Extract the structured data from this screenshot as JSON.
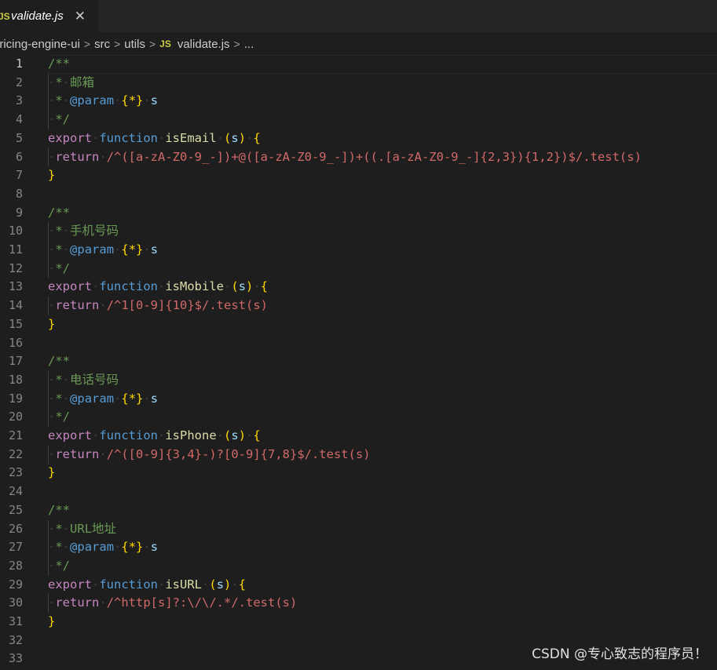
{
  "tab": {
    "icon": "JS",
    "title": "validate.js",
    "close": "✕"
  },
  "breadcrumb": {
    "project": "pricing-engine-ui",
    "src": "src",
    "utils": "utils",
    "file_icon": "JS",
    "file": "validate.js",
    "more": "..."
  },
  "line_numbers": [
    "1",
    "2",
    "3",
    "4",
    "5",
    "6",
    "7",
    "8",
    "9",
    "10",
    "11",
    "12",
    "13",
    "14",
    "15",
    "16",
    "17",
    "18",
    "19",
    "20",
    "21",
    "22",
    "23",
    "24",
    "25",
    "26",
    "27",
    "28",
    "29",
    "30",
    "31",
    "32",
    "33"
  ],
  "code": {
    "comment_open": "/**",
    "comment_star": "*",
    "comment_close": "*/",
    "email_desc": "邮箱",
    "mobile_desc": "手机号码",
    "phone_desc": "电话号码",
    "url_desc": "URL地址",
    "param_tag": "@param",
    "param_type": "{*}",
    "param_name": "s",
    "kw_export": "export",
    "kw_function": "function",
    "kw_return": "return",
    "fn_email": "isEmail",
    "fn_mobile": "isMobile",
    "fn_phone": "isPhone",
    "fn_url": "isURL",
    "email_regex": "/^([a-zA-Z0-9_-])+@([a-zA-Z0-9_-])+((.[a-zA-Z0-9_-]{2,3}){1,2})$/.test(s)",
    "mobile_regex": "/^1[0-9]{10}$/.test(s)",
    "phone_regex": "/^([0-9]{3,4}-)?[0-9]{7,8}$/.test(s)",
    "url_regex": "/^http[s]?:\\/\\/.*/.test(s)"
  },
  "watermark": "CSDN @专心致志的程序员！"
}
